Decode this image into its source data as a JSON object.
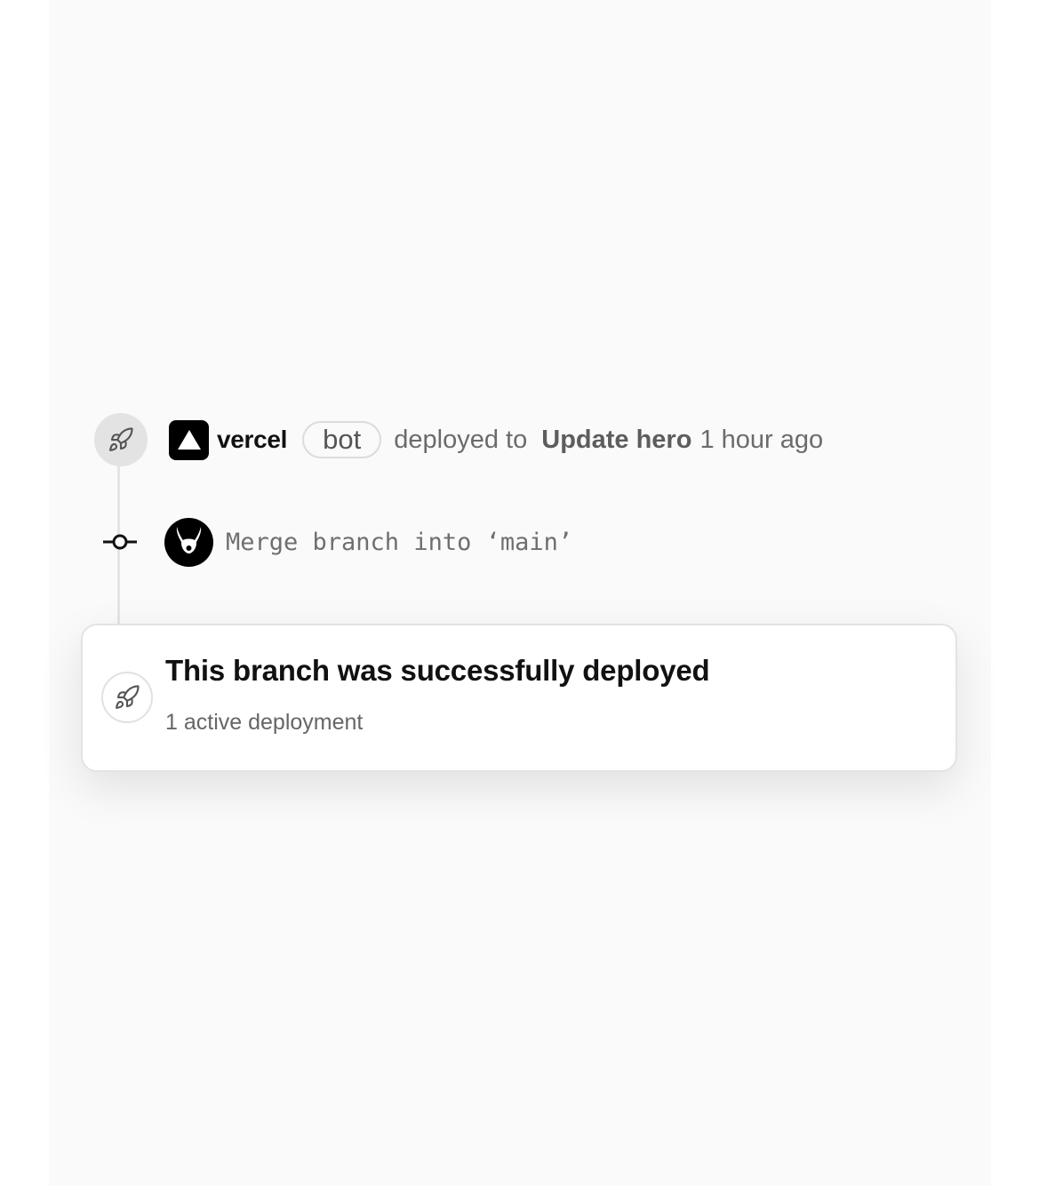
{
  "timeline": {
    "deploy_event": {
      "icon": "rocket-icon",
      "actor_logo": "vercel-logo-icon",
      "actor": "vercel",
      "badge": "bot",
      "action": "deployed to",
      "target": "Update hero",
      "time": "1 hour ago"
    },
    "commit": {
      "icon": "git-commit-icon",
      "avatar": "rabbit-avatar",
      "message": "Merge branch into ‘main’"
    }
  },
  "status_card": {
    "icon": "rocket-icon",
    "title": "This branch was successfully deployed",
    "subtitle": "1 active deployment"
  },
  "colors": {
    "panel_background": "#fafafa",
    "line": "#e4e4e4",
    "text_primary": "#111111",
    "text_muted": "#6b6b6b"
  }
}
